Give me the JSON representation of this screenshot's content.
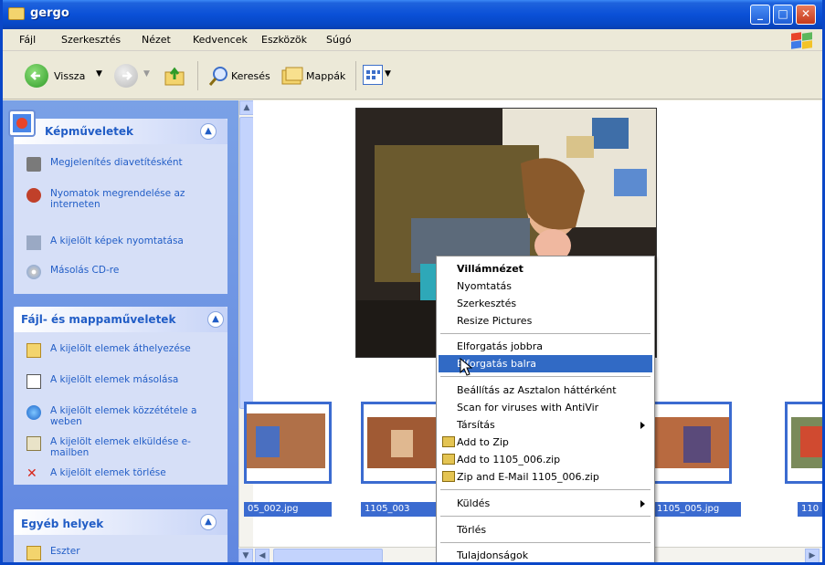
{
  "window": {
    "title": "gergo"
  },
  "menubar": [
    "Fájl",
    "Szerkesztés",
    "Nézet",
    "Kedvencek",
    "Eszközök",
    "Súgó"
  ],
  "toolbar": {
    "back": "Vissza",
    "search": "Keresés",
    "folders": "Mappák"
  },
  "taskpane": {
    "image_tasks": {
      "title": "Képműveletek",
      "items": [
        "Megjelenítés diavetítésként",
        "Nyomatok megrendelése az interneten",
        "A kijelölt képek nyomtatása",
        "Másolás CD-re"
      ]
    },
    "file_tasks": {
      "title": "Fájl- és mappaműveletek",
      "items": [
        "A kijelölt elemek áthelyezése",
        "A kijelölt elemek másolása",
        "A kijelölt elemek közzététele a weben",
        "A kijelölt elemek elküldése e-mailben",
        "A kijelölt elemek törlése"
      ]
    },
    "other_places": {
      "title": "Egyéb helyek",
      "items": [
        "Eszter"
      ]
    }
  },
  "thumbnails": {
    "labels": [
      "05_002.jpg",
      "1105_003",
      "1105_005.jpg",
      "110"
    ]
  },
  "context_menu": {
    "items": [
      "Villámnézet",
      "Nyomtatás",
      "Szerkesztés",
      "Resize Pictures",
      "Elforgatás jobbra",
      "Elforgatás balra",
      "Beállítás az Asztalon háttérként",
      "Scan for viruses with AntiVir",
      "Társítás",
      "Add to Zip",
      "Add to 1105_006.zip",
      "Zip and E-Mail 1105_006.zip",
      "Küldés",
      "Törlés",
      "Tulajdonságok"
    ],
    "highlighted": "Elforgatás balra"
  },
  "colors": {
    "title_bar": "#0a50d7",
    "highlight": "#316ac5",
    "task_link": "#215dc6"
  },
  "icons": [
    "folder-icon",
    "minimize-icon",
    "maximize-icon",
    "close-icon",
    "windows-flag-icon",
    "back-arrow-icon",
    "forward-arrow-icon",
    "up-folder-icon",
    "search-icon",
    "folders-icon",
    "view-icon"
  ]
}
